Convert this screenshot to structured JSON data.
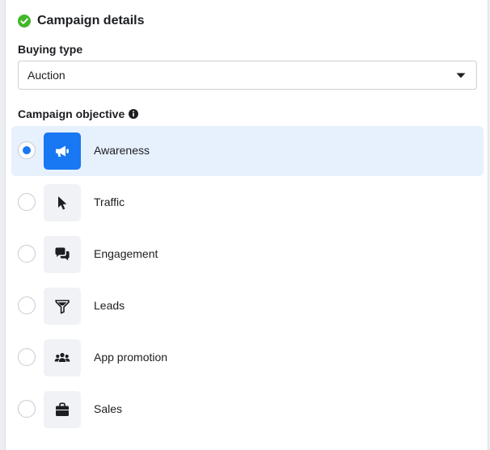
{
  "header": {
    "title": "Campaign details",
    "status_icon": "check-circle-icon",
    "status_color": "#42b72a"
  },
  "buying_type": {
    "label": "Buying type",
    "selected": "Auction",
    "dropdown_icon": "caret-down-icon"
  },
  "objective": {
    "label": "Campaign objective",
    "info_icon": "info-icon",
    "selected_index": 0,
    "accent_color": "#1877f2",
    "options": [
      {
        "label": "Awareness",
        "icon": "megaphone-icon"
      },
      {
        "label": "Traffic",
        "icon": "cursor-icon"
      },
      {
        "label": "Engagement",
        "icon": "chat-bubbles-icon"
      },
      {
        "label": "Leads",
        "icon": "funnel-icon"
      },
      {
        "label": "App promotion",
        "icon": "people-icon"
      },
      {
        "label": "Sales",
        "icon": "shopping-bag-icon"
      }
    ]
  }
}
